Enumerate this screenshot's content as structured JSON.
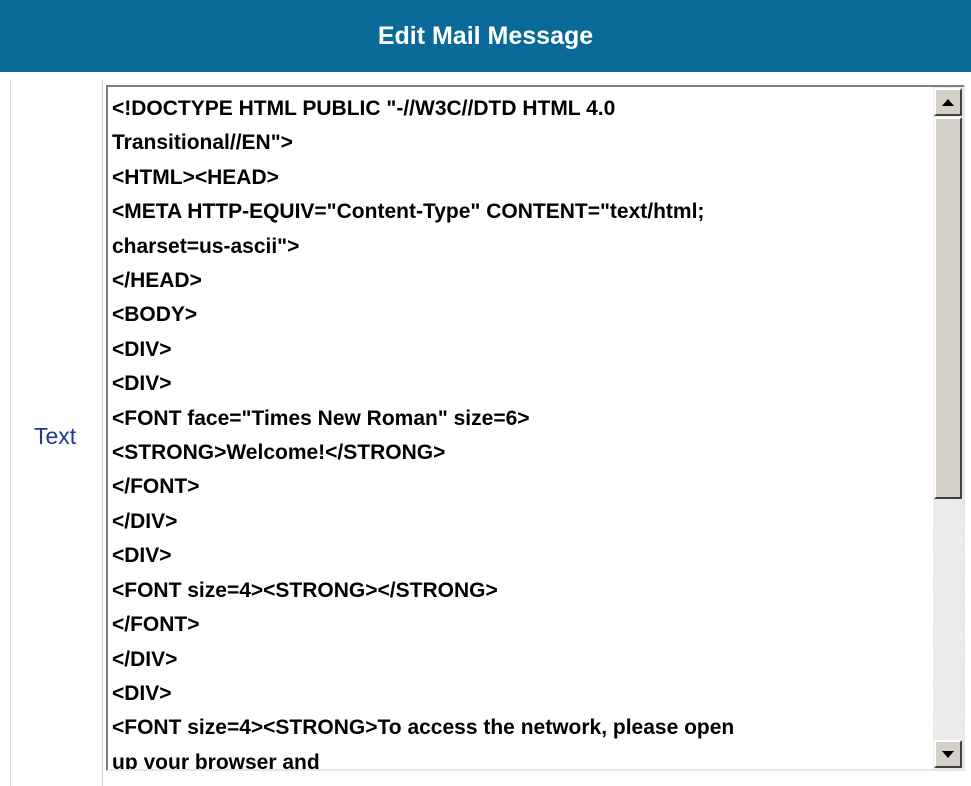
{
  "header": {
    "title": "Edit Mail Message"
  },
  "form": {
    "field_label": "Text",
    "text_value": "<!DOCTYPE HTML PUBLIC \"-//W3C//DTD HTML 4.0\nTransitional//EN\">\n<HTML><HEAD>\n<META HTTP-EQUIV=\"Content-Type\" CONTENT=\"text/html;\ncharset=us-ascii\">\n</HEAD>\n<BODY>\n<DIV>\n<DIV>\n<FONT face=\"Times New Roman\" size=6>\n<STRONG>Welcome!</STRONG>\n</FONT>\n</DIV>\n<DIV>\n<FONT size=4><STRONG></STRONG>\n</FONT>\n</DIV>\n<DIV>\n<FONT size=4><STRONG>To access the network, please open\nup your browser and"
  },
  "scrollbar": {
    "up_icon": "scroll-up-arrow-icon",
    "down_icon": "scroll-down-arrow-icon"
  },
  "colors": {
    "header_bg": "#0a6a97",
    "header_text": "#ffffff",
    "label_text": "#1f3a93"
  }
}
